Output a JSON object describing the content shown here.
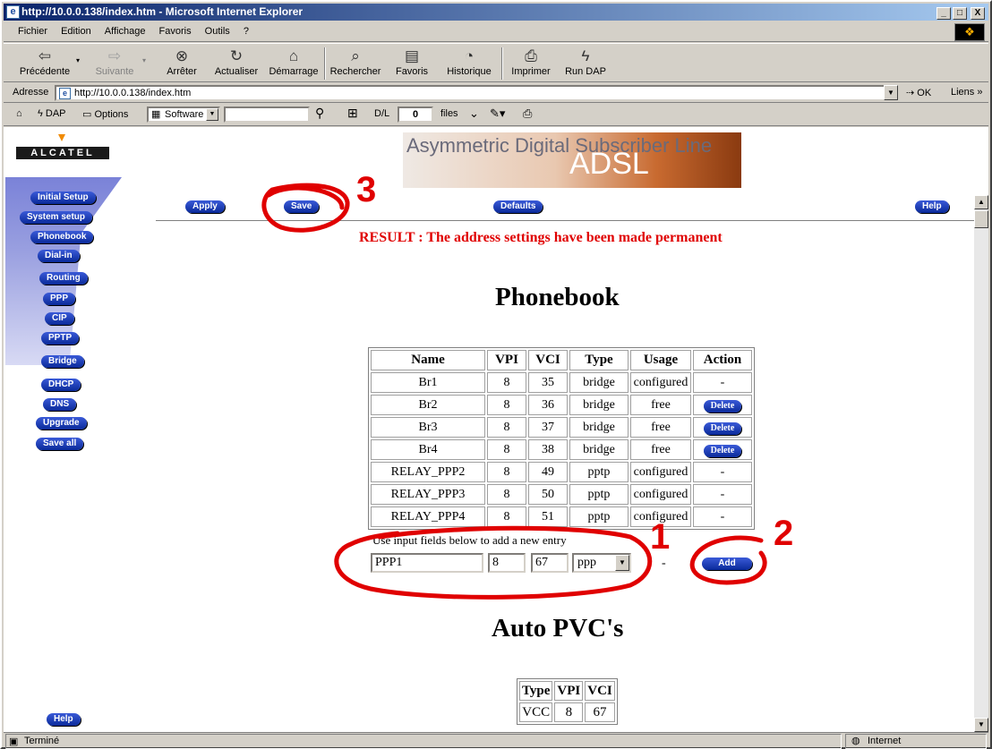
{
  "window": {
    "title": "http://10.0.0.138/index.htm - Microsoft Internet Explorer",
    "buttons": [
      "_",
      "□",
      "X"
    ]
  },
  "menu": [
    "Fichier",
    "Edition",
    "Affichage",
    "Favoris",
    "Outils",
    "?"
  ],
  "toolbar": {
    "back": "Précédente",
    "forward": "Suivante",
    "stop": "Arrêter",
    "refresh": "Actualiser",
    "home": "Démarrage",
    "search": "Rechercher",
    "favorites": "Favoris",
    "history": "Historique",
    "print": "Imprimer",
    "rundap": "Run DAP"
  },
  "address": {
    "label": "Adresse",
    "url": "http://10.0.0.138/index.htm",
    "go": "OK",
    "links": "Liens"
  },
  "linkbar": {
    "dap": "DAP",
    "options": "Options",
    "software": "Software",
    "dl_label": "D/L",
    "dl_value": "0",
    "files": "files"
  },
  "page": {
    "logo": "ALCATEL",
    "banner_top": "Asymmetric Digital Subscriber Line",
    "banner_main": "ADSL",
    "nav": [
      "Initial Setup",
      "System setup",
      "Phonebook",
      "Dial-in",
      "Routing",
      "PPP",
      "CIP",
      "PPTP",
      "Bridge",
      "DHCP",
      "DNS",
      "Upgrade",
      "Save all"
    ],
    "help_bottom": "Help",
    "actions": {
      "apply": "Apply",
      "save": "Save",
      "defaults": "Defaults",
      "help": "Help"
    },
    "result": "RESULT : The address settings have been made permanent",
    "phonebook_title": "Phonebook",
    "phonebook_headers": [
      "Name",
      "VPI",
      "VCI",
      "Type",
      "Usage",
      "Action"
    ],
    "phonebook_rows": [
      {
        "name": "Br1",
        "vpi": "8",
        "vci": "35",
        "type": "bridge",
        "usage": "configured",
        "action": "-"
      },
      {
        "name": "Br2",
        "vpi": "8",
        "vci": "36",
        "type": "bridge",
        "usage": "free",
        "action": "Delete"
      },
      {
        "name": "Br3",
        "vpi": "8",
        "vci": "37",
        "type": "bridge",
        "usage": "free",
        "action": "Delete"
      },
      {
        "name": "Br4",
        "vpi": "8",
        "vci": "38",
        "type": "bridge",
        "usage": "free",
        "action": "Delete"
      },
      {
        "name": "RELAY_PPP2",
        "vpi": "8",
        "vci": "49",
        "type": "pptp",
        "usage": "configured",
        "action": "-"
      },
      {
        "name": "RELAY_PPP3",
        "vpi": "8",
        "vci": "50",
        "type": "pptp",
        "usage": "configured",
        "action": "-"
      },
      {
        "name": "RELAY_PPP4",
        "vpi": "8",
        "vci": "51",
        "type": "pptp",
        "usage": "configured",
        "action": "-"
      }
    ],
    "new_entry_hint": "Use input fields below to add a new entry",
    "new_entry": {
      "name": "PPP1",
      "vpi": "8",
      "vci": "67",
      "type": "ppp",
      "usage": "-",
      "add": "Add"
    },
    "autopvc_title": "Auto PVC's",
    "autopvc_headers": [
      "Type",
      "VPI",
      "VCI"
    ],
    "autopvc_rows": [
      {
        "type": "VCC",
        "vpi": "8",
        "vci": "67"
      }
    ]
  },
  "annotations": {
    "one": "1",
    "two": "2",
    "three": "3",
    "color": "#e00000"
  },
  "status": {
    "left": "Terminé",
    "zone": "Internet"
  }
}
